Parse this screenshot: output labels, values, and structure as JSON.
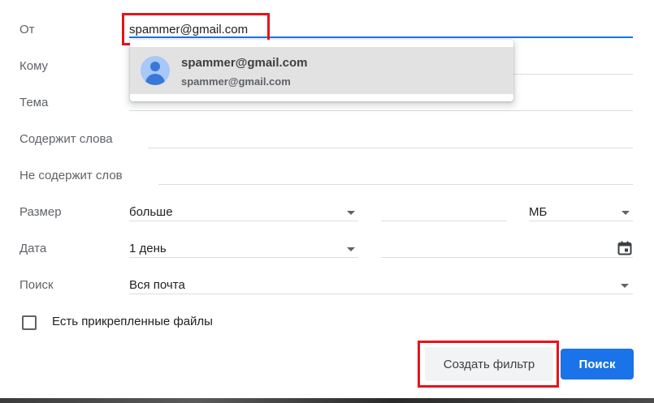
{
  "form": {
    "from_label": "От",
    "from_value": "spammer@gmail.com",
    "to_label": "Кому",
    "subject_label": "Тема",
    "has_words_label": "Содержит слова",
    "not_has_words_label": "Не содержит слов",
    "size_label": "Размер",
    "size_operator": "больше",
    "size_unit": "МБ",
    "date_label": "Дата",
    "date_value": "1 день",
    "search_label": "Поиск",
    "search_scope": "Вся почта",
    "attachment_label": "Есть прикрепленные файлы"
  },
  "autocomplete": {
    "name": "spammer@gmail.com",
    "email": "spammer@gmail.com"
  },
  "buttons": {
    "create_filter": "Создать фильтр",
    "search": "Поиск"
  },
  "colors": {
    "accent": "#1a73e8",
    "highlight": "#e8121c"
  }
}
